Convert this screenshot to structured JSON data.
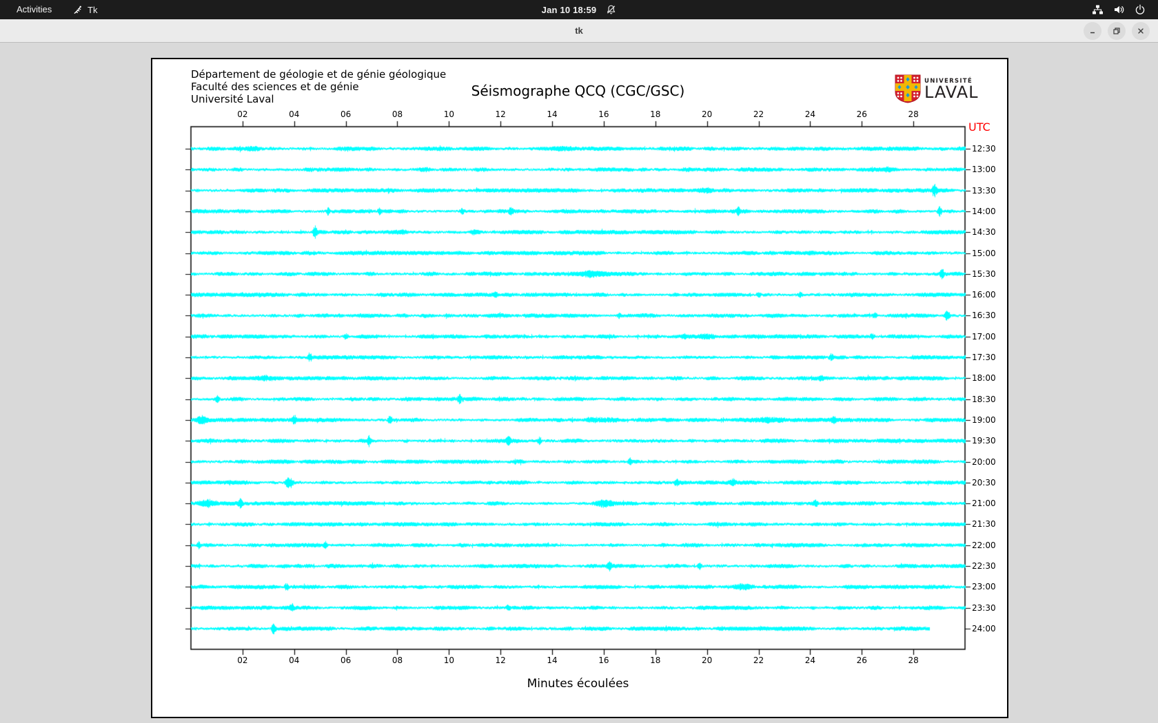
{
  "desktop": {
    "topbar": {
      "activities": "Activities",
      "app_name": "Tk",
      "clock": "Jan 10 18:59",
      "icons": [
        "tk-icon",
        "bell-slash-icon",
        "network-icon",
        "volume-icon",
        "power-icon"
      ]
    },
    "window": {
      "title": "tk",
      "buttons": [
        "minimize",
        "maximize",
        "close"
      ]
    }
  },
  "header": {
    "dept_lines": [
      "Département de géologie et de génie géologique",
      "Faculté des sciences et de génie",
      "Université Laval"
    ],
    "logo": {
      "line1": "UNIVERSITÉ",
      "line2": "LAVAL"
    }
  },
  "chart_data": {
    "type": "line",
    "title": "Séismographe QCQ (CGC/GSC)",
    "xlabel": "Minutes écoulées",
    "utc_axis_label": "UTC",
    "x_range": [
      0,
      30
    ],
    "x_ticks": [
      "02",
      "04",
      "06",
      "08",
      "10",
      "12",
      "14",
      "16",
      "18",
      "20",
      "22",
      "24",
      "26",
      "28"
    ],
    "grid": false,
    "trace_color": "#00ffff",
    "utc_label_color": "#ff0000",
    "axis_color": "#000000",
    "spike_format": "[minute, amplitude_px, half_width_min]",
    "traces": [
      {
        "utc": "12:30",
        "end_min": 30,
        "spikes": [
          [
            2.5,
            2,
            0.5
          ],
          [
            14.5,
            2,
            0.6
          ]
        ]
      },
      {
        "utc": "13:00",
        "end_min": 30,
        "spikes": [
          [
            9,
            2,
            0.5
          ],
          [
            27,
            2.5,
            0.15
          ]
        ]
      },
      {
        "utc": "13:30",
        "end_min": 30,
        "spikes": [
          [
            20,
            2,
            0.4
          ],
          [
            28.8,
            9,
            0.15
          ]
        ]
      },
      {
        "utc": "14:00",
        "end_min": 30,
        "spikes": [
          [
            5.3,
            6,
            0.12
          ],
          [
            7.3,
            5,
            0.12
          ],
          [
            10.5,
            5,
            0.12
          ],
          [
            12.4,
            6,
            0.12
          ],
          [
            21.2,
            6,
            0.12
          ],
          [
            29,
            7,
            0.12
          ]
        ]
      },
      {
        "utc": "14:30",
        "end_min": 30,
        "spikes": [
          [
            4.8,
            8,
            0.12
          ],
          [
            8.2,
            3,
            0.3
          ],
          [
            11,
            2.5,
            0.3
          ]
        ]
      },
      {
        "utc": "15:00",
        "end_min": 30,
        "spikes": [
          [
            24,
            2,
            0.3
          ]
        ]
      },
      {
        "utc": "15:30",
        "end_min": 30,
        "spikes": [
          [
            15.5,
            3,
            0.8
          ],
          [
            29.1,
            8,
            0.12
          ]
        ]
      },
      {
        "utc": "16:00",
        "end_min": 30,
        "spikes": [
          [
            11.8,
            4,
            0.12
          ],
          [
            22,
            5,
            0.12
          ],
          [
            23.6,
            5,
            0.12
          ]
        ]
      },
      {
        "utc": "16:30",
        "end_min": 30,
        "spikes": [
          [
            16.6,
            5,
            0.12
          ],
          [
            26.5,
            4,
            0.12
          ],
          [
            29.3,
            8,
            0.15
          ]
        ]
      },
      {
        "utc": "17:00",
        "end_min": 30,
        "spikes": [
          [
            6,
            4,
            0.15
          ],
          [
            19.1,
            4,
            0.12
          ],
          [
            20,
            3.5,
            0.4
          ],
          [
            26.4,
            4,
            0.12
          ]
        ]
      },
      {
        "utc": "17:30",
        "end_min": 30,
        "spikes": [
          [
            4.6,
            8,
            0.12
          ],
          [
            24.8,
            5,
            0.12
          ]
        ]
      },
      {
        "utc": "18:00",
        "end_min": 30,
        "spikes": [
          [
            2.9,
            3.5,
            0.7
          ],
          [
            24.4,
            3.5,
            0.12
          ]
        ]
      },
      {
        "utc": "18:30",
        "end_min": 30,
        "spikes": [
          [
            1,
            5,
            0.12
          ],
          [
            10.4,
            6,
            0.12
          ]
        ]
      },
      {
        "utc": "19:00",
        "end_min": 30,
        "spikes": [
          [
            0.4,
            5,
            0.3
          ],
          [
            4,
            7,
            0.12
          ],
          [
            7.7,
            6,
            0.12
          ],
          [
            15.9,
            3,
            0.8
          ],
          [
            22.4,
            3,
            0.8
          ],
          [
            24.9,
            5,
            0.12
          ]
        ]
      },
      {
        "utc": "19:30",
        "end_min": 30,
        "spikes": [
          [
            6.9,
            8,
            0.12
          ],
          [
            12.3,
            6,
            0.12
          ],
          [
            13.5,
            6,
            0.12
          ]
        ]
      },
      {
        "utc": "20:00",
        "end_min": 30,
        "spikes": [
          [
            17,
            5,
            0.12
          ]
        ]
      },
      {
        "utc": "20:30",
        "end_min": 30,
        "spikes": [
          [
            3.8,
            8,
            0.2
          ],
          [
            18.8,
            5,
            0.12
          ],
          [
            21,
            5,
            0.15
          ]
        ]
      },
      {
        "utc": "21:00",
        "end_min": 30,
        "spikes": [
          [
            0.6,
            4,
            0.5
          ],
          [
            1.9,
            6,
            0.12
          ],
          [
            16,
            4,
            0.6
          ],
          [
            24.2,
            5,
            0.12
          ]
        ]
      },
      {
        "utc": "21:30",
        "end_min": 30,
        "spikes": []
      },
      {
        "utc": "22:00",
        "end_min": 30,
        "spikes": [
          [
            0.3,
            7,
            0.12
          ],
          [
            5.2,
            6,
            0.12
          ]
        ]
      },
      {
        "utc": "22:30",
        "end_min": 30,
        "spikes": [
          [
            16.2,
            6,
            0.12
          ],
          [
            19.7,
            5,
            0.12
          ]
        ]
      },
      {
        "utc": "23:00",
        "end_min": 30,
        "spikes": [
          [
            3.7,
            6,
            0.12
          ],
          [
            21.3,
            3.5,
            0.6
          ]
        ]
      },
      {
        "utc": "23:30",
        "end_min": 30,
        "spikes": [
          [
            3.9,
            5,
            0.12
          ],
          [
            12.3,
            3,
            0.12
          ]
        ]
      },
      {
        "utc": "24:00",
        "end_min": 28.6,
        "spikes": [
          [
            3.2,
            9,
            0.12
          ]
        ]
      }
    ]
  }
}
